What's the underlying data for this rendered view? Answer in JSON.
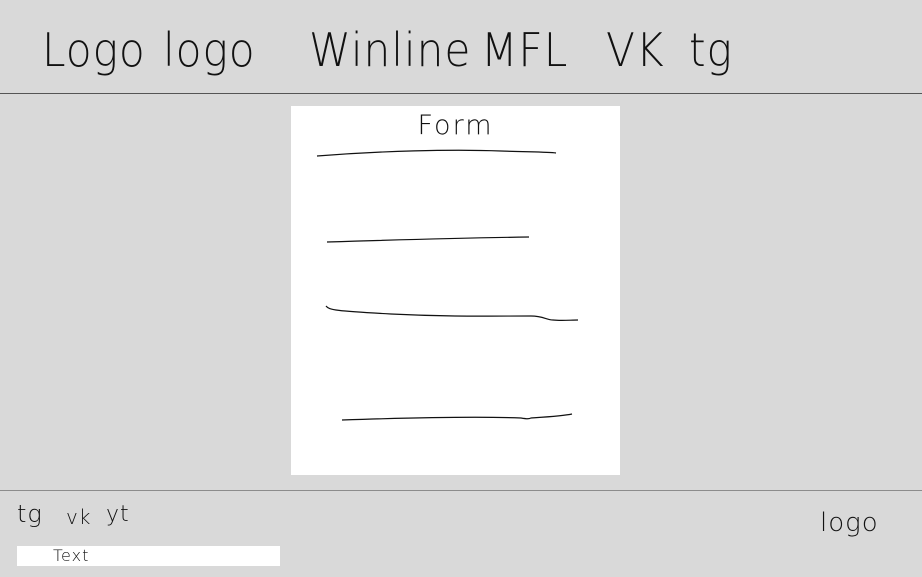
{
  "header": {
    "items": [
      "Logo",
      "logo",
      "Winline",
      "MFL",
      "VK",
      "tg"
    ]
  },
  "form": {
    "title": "Form"
  },
  "footer": {
    "social": [
      "tg",
      "vk",
      "yt"
    ],
    "text": "Text",
    "logo": "logo"
  }
}
